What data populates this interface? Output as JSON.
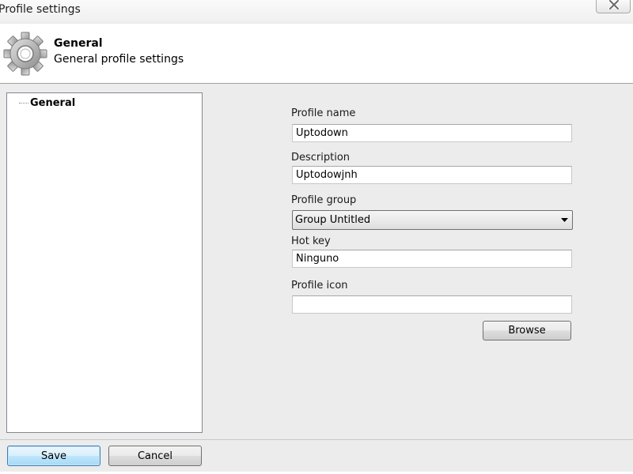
{
  "window": {
    "title": "Profile settings"
  },
  "header": {
    "title": "General",
    "subtitle": "General profile settings",
    "icon": "gear-icon"
  },
  "tree": {
    "items": [
      {
        "label": "General"
      }
    ]
  },
  "form": {
    "profile_name": {
      "label": "Profile name",
      "value": "Uptodown"
    },
    "description": {
      "label": "Description",
      "value": "Uptodowjnh"
    },
    "profile_group": {
      "label": "Profile group",
      "value": "Group Untitled"
    },
    "hot_key": {
      "label": "Hot key",
      "value": "Ninguno"
    },
    "profile_icon": {
      "label": "Profile icon",
      "value": ""
    },
    "browse_label": "Browse"
  },
  "footer": {
    "save_label": "Save",
    "cancel_label": "Cancel"
  },
  "colors": {
    "default_button_border": "#3c7fb1",
    "default_button_fill": "#bee6fd"
  }
}
